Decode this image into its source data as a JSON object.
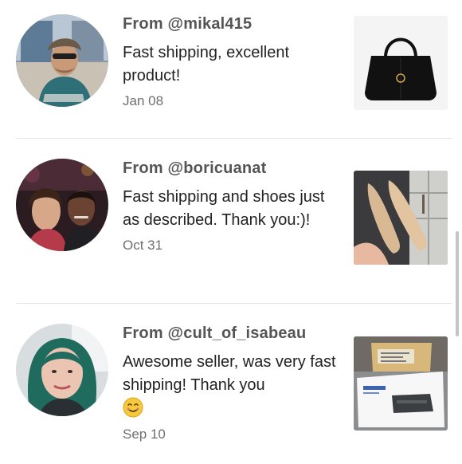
{
  "reviews": [
    {
      "author": "From @mikal415",
      "comment": "Fast shipping, excellent product!",
      "date": "Jan 08",
      "avatar_icon": "user-avatar",
      "product_icon": "black-handbag"
    },
    {
      "author": "From @boricuanat",
      "comment": "Fast shipping and shoes just as described. Thank you:)!",
      "date": "Oct 31",
      "avatar_icon": "user-avatar",
      "product_icon": "tan-heels"
    },
    {
      "author": "From @cult_of_isabeau",
      "comment": "Awesome seller, was very fast shipping! Thank you",
      "emoji": "smiling-face-emoji",
      "date": "Sep 10",
      "avatar_icon": "user-avatar",
      "product_icon": "label-printer-box"
    }
  ],
  "colors": {
    "author_text": "#555555",
    "comment_text": "#222222",
    "date_text": "#6f6f6f",
    "divider": "#e6e6e6"
  }
}
